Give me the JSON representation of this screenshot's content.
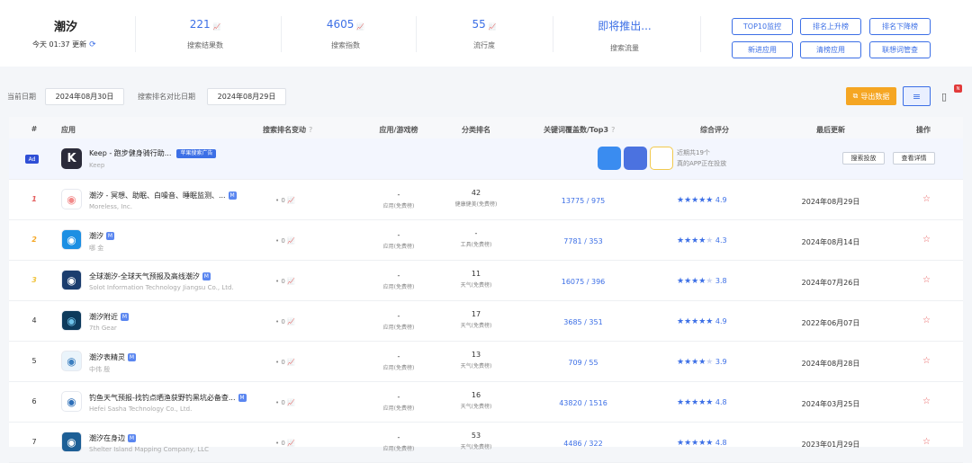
{
  "summary": {
    "keyword": "潮汐",
    "update_text": "今天 01:37 更新",
    "stats": [
      {
        "value": "221",
        "label": "搜索结果数"
      },
      {
        "value": "4605",
        "label": "搜索指数"
      },
      {
        "value": "55",
        "label": "流行度"
      },
      {
        "value": "即将推出...",
        "label": "搜索流量"
      }
    ],
    "buttons": [
      "TOP10监控",
      "排名上升榜",
      "排名下降榜",
      "新进应用",
      "清榜应用",
      "联想词管查"
    ]
  },
  "filters": {
    "current_date_label": "当前日期",
    "current_date": "2024年08月30日",
    "compare_label": "搜索排名对比日期",
    "compare_date": "2024年08月29日",
    "export_label": "导出数据",
    "new_badge": "N"
  },
  "table": {
    "headers": [
      "#",
      "应用",
      "搜索排名变动",
      "应用/游戏榜",
      "分类排名",
      "关键词覆盖数/Top3",
      "综合评分",
      "最后更新",
      "操作"
    ],
    "ad_row": {
      "badge": "Ad",
      "name": "Keep - 跑步健身骑行助...",
      "tag": "苹果搜索广告",
      "developer": "Keep",
      "note_line1": "近期共19个",
      "note_line2": "真的APP正在投放",
      "btn_detail": "搜索投放",
      "btn_view": "查看详情",
      "colors": [
        "#3a8cf0",
        "#4b72e0",
        "#f2c94c"
      ]
    },
    "rows": [
      {
        "rank": "1",
        "medal": "#e35d5d",
        "name": "潮汐 - 冥想、助眠、白噪音、睡眠监测、...",
        "developer": "Moreless, Inc.",
        "change": "• 0",
        "list_a": "-",
        "list_b": "应用(免费榜)",
        "cat_a": "42",
        "cat_b": "健康健美(免费榜)",
        "kw": "13775 / 975",
        "stars": 5,
        "half": false,
        "score": "4.9",
        "updated": "2024年08月29日",
        "icon_bg": "#ffffff",
        "icon_fg": "#f28a8a"
      },
      {
        "rank": "2",
        "medal": "#f5a623",
        "name": "潮汐",
        "developer": "哪 金",
        "change": "• 0",
        "list_a": "-",
        "list_b": "应用(免费榜)",
        "cat_a": "-",
        "cat_b": "工具(免费榜)",
        "kw": "7781 / 353",
        "stars": 4,
        "half": true,
        "score": "4.3",
        "updated": "2024年08月14日",
        "icon_bg": "#1c8fe3",
        "icon_fg": "#ffffff"
      },
      {
        "rank": "3",
        "medal": "#f0c33c",
        "name": "全球潮汐-全球天气预报及高线潮汐",
        "developer": "Solot Information Technology Jiangsu Co., Ltd.",
        "change": "• 0",
        "list_a": "-",
        "list_b": "应用(免费榜)",
        "cat_a": "11",
        "cat_b": "天气(免费榜)",
        "kw": "16075 / 396",
        "stars": 4,
        "half": false,
        "score": "3.8",
        "updated": "2024年07月26日",
        "icon_bg": "#1b3d6e",
        "icon_fg": "#ffffff"
      },
      {
        "rank": "4",
        "medal": "",
        "name": "潮汐附近",
        "developer": "7th Gear",
        "change": "• 0",
        "list_a": "-",
        "list_b": "应用(免费榜)",
        "cat_a": "17",
        "cat_b": "天气(免费榜)",
        "kw": "3685 / 351",
        "stars": 5,
        "half": false,
        "score": "4.9",
        "updated": "2022年06月07日",
        "icon_bg": "#0d3a5c",
        "icon_fg": "#6fc3ea"
      },
      {
        "rank": "5",
        "medal": "",
        "name": "潮汐表精灵",
        "developer": "中伟 殷",
        "change": "• 0",
        "list_a": "-",
        "list_b": "应用(免费榜)",
        "cat_a": "13",
        "cat_b": "天气(免费榜)",
        "kw": "709 / 55",
        "stars": 4,
        "half": false,
        "score": "3.9",
        "updated": "2024年08月28日",
        "icon_bg": "#eaf4fb",
        "icon_fg": "#3a7fc0"
      },
      {
        "rank": "6",
        "medal": "",
        "name": "钓鱼天气预报-找钓点晒渔获野钓黑坑必备查...",
        "developer": "Hefei Sasha Technology Co., Ltd.",
        "change": "• 0",
        "list_a": "-",
        "list_b": "应用(免费榜)",
        "cat_a": "16",
        "cat_b": "天气(免费榜)",
        "kw": "43820 / 1516",
        "stars": 5,
        "half": false,
        "score": "4.8",
        "updated": "2024年03月25日",
        "icon_bg": "#ffffff",
        "icon_fg": "#2d6fb8"
      },
      {
        "rank": "7",
        "medal": "",
        "name": "潮汐在身边",
        "developer": "Shelter Island Mapping Company, LLC",
        "change": "• 0",
        "list_a": "-",
        "list_b": "应用(免费榜)",
        "cat_a": "53",
        "cat_b": "天气(免费榜)",
        "kw": "4486 / 322",
        "stars": 5,
        "half": false,
        "score": "4.8",
        "updated": "2023年01月29日",
        "icon_bg": "#1d5f96",
        "icon_fg": "#ffffff"
      }
    ]
  }
}
